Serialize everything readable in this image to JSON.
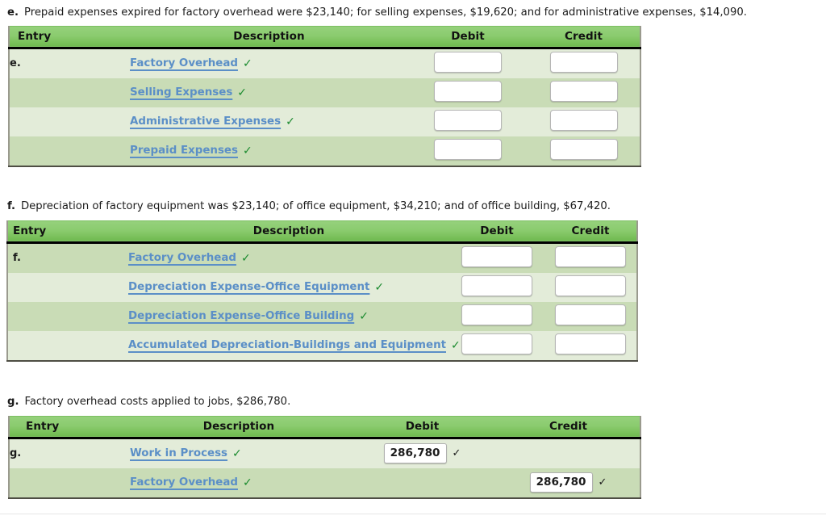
{
  "colors": {
    "header_green_top": "#96d17c",
    "header_green_bottom": "#6fb94f",
    "row_light": "#e3ecd9",
    "row_dark": "#c9dcb6",
    "link_blue": "#5b8fc7",
    "check_green": "#1a8a2e"
  },
  "columns": {
    "entry": "Entry",
    "description": "Description",
    "debit": "Debit",
    "credit": "Credit"
  },
  "sections": [
    {
      "letter": "e.",
      "prompt": "Prepaid expenses expired for factory overhead were $23,140; for selling expenses, $19,620; and for administrative expenses, $14,090.",
      "entry_label": "e.",
      "rows": [
        {
          "account": "Factory Overhead",
          "check": "✓",
          "debit": "",
          "credit": ""
        },
        {
          "account": "Selling Expenses",
          "check": "✓",
          "debit": "",
          "credit": ""
        },
        {
          "account": "Administrative Expenses",
          "check": "✓",
          "debit": "",
          "credit": ""
        },
        {
          "account": "Prepaid Expenses",
          "check": "✓",
          "debit": "",
          "credit": ""
        }
      ]
    },
    {
      "letter": "f.",
      "prompt": "Depreciation of factory equipment was $23,140; of office equipment, $34,210; and of office building, $67,420.",
      "entry_label": "f.",
      "rows": [
        {
          "account": "Factory Overhead",
          "check": "✓",
          "debit": "",
          "credit": ""
        },
        {
          "account": "Depreciation Expense-Office Equipment",
          "check": "✓",
          "debit": "",
          "credit": ""
        },
        {
          "account": "Depreciation Expense-Office Building",
          "check": "✓",
          "debit": "",
          "credit": ""
        },
        {
          "account": "Accumulated Depreciation-Buildings and Equipment",
          "check": "✓",
          "debit": "",
          "credit": ""
        }
      ]
    },
    {
      "letter": "g.",
      "prompt": "Factory overhead costs applied to jobs, $286,780.",
      "entry_label": "g.",
      "rows": [
        {
          "account": "Work in Process",
          "check": "✓",
          "debit": "286,780",
          "debit_check": "✓",
          "credit": ""
        },
        {
          "account": "Factory Overhead",
          "check": "✓",
          "debit": "",
          "credit": "286,780",
          "credit_check": "✓"
        }
      ]
    }
  ]
}
